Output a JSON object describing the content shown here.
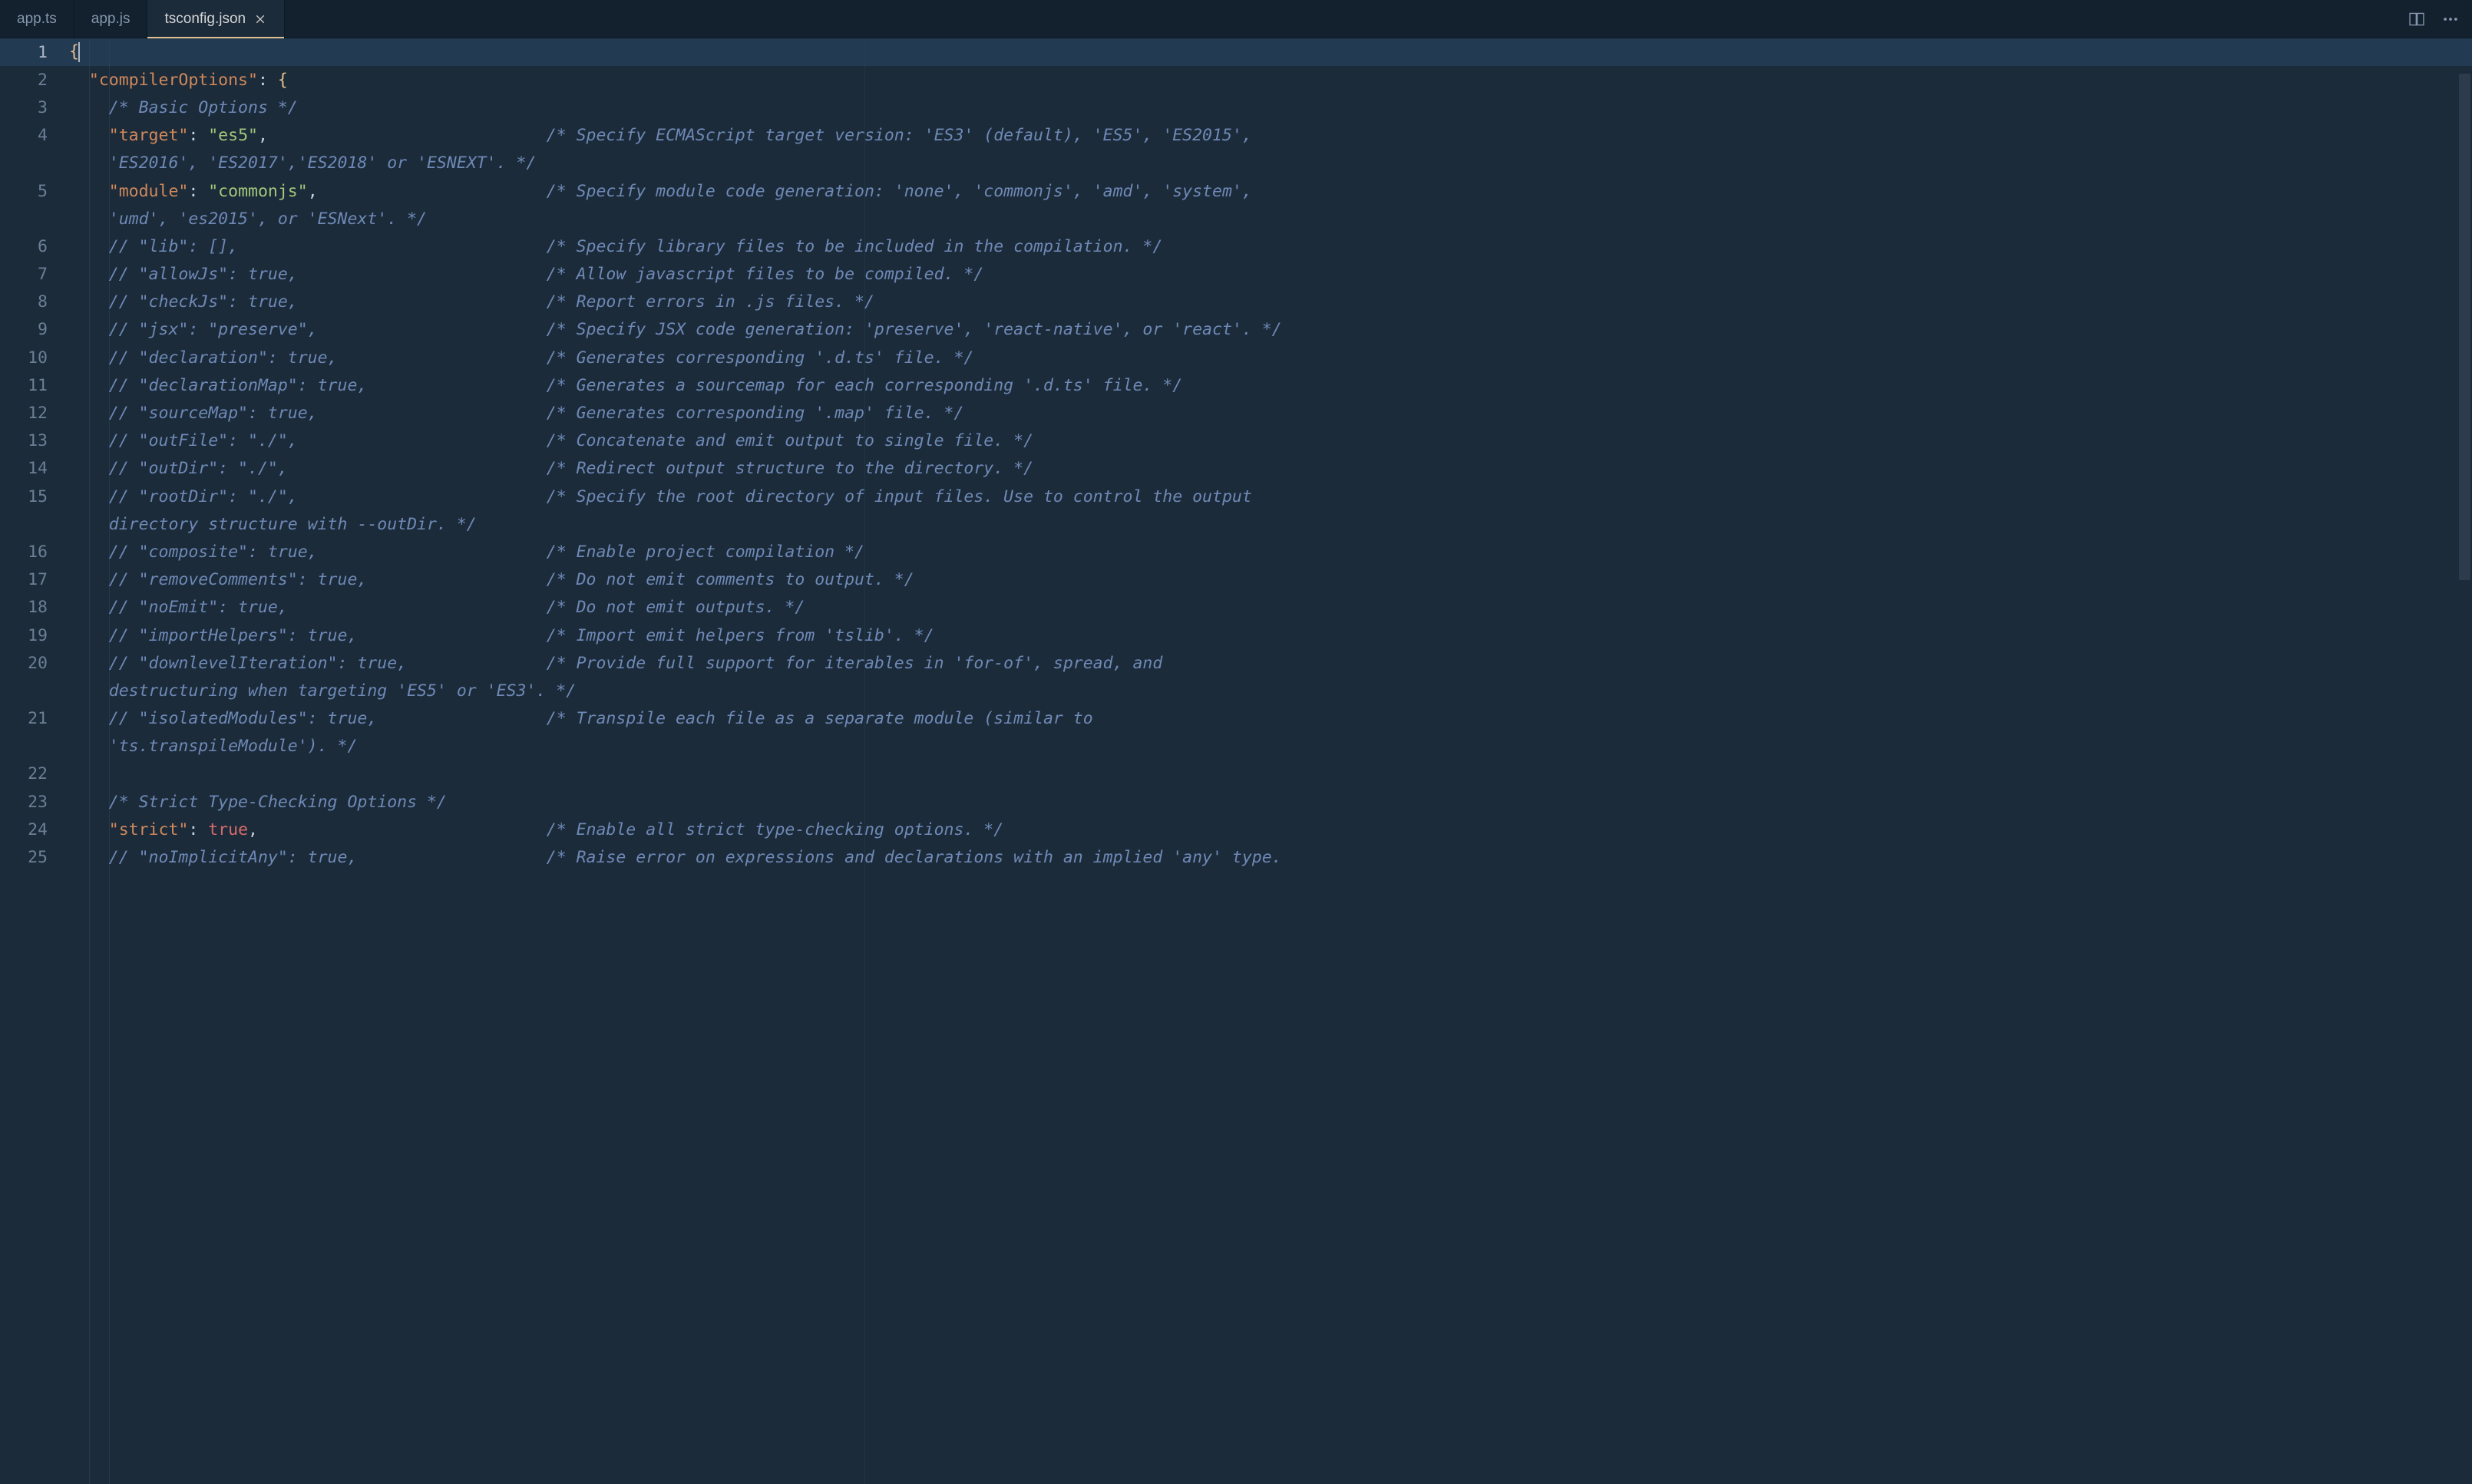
{
  "tabs": [
    {
      "label": "app.ts",
      "active": false,
      "dirty": false
    },
    {
      "label": "app.js",
      "active": false,
      "dirty": false
    },
    {
      "label": "tsconfig.json",
      "active": true,
      "dirty": false
    }
  ],
  "editor": {
    "rulerColumn": 80,
    "commentColumn": 48,
    "cursorLine": 1,
    "lines": [
      {
        "n": 1,
        "indent": 0,
        "segs": [
          {
            "t": "{",
            "c": "brace"
          }
        ]
      },
      {
        "n": 2,
        "indent": 2,
        "segs": [
          {
            "t": "\"compilerOptions\"",
            "c": "key"
          },
          {
            "t": ": ",
            "c": "punc"
          },
          {
            "t": "{",
            "c": "brace"
          }
        ]
      },
      {
        "n": 3,
        "indent": 4,
        "segs": [
          {
            "t": "/* Basic Options */",
            "c": "cmt"
          }
        ]
      },
      {
        "n": 4,
        "indent": 4,
        "segs": [
          {
            "t": "\"target\"",
            "c": "key"
          },
          {
            "t": ": ",
            "c": "punc"
          },
          {
            "t": "\"es5\"",
            "c": "str"
          },
          {
            "t": ",",
            "c": "punc"
          }
        ],
        "tail": "/* Specify ECMAScript target version: 'ES3' (default), 'ES5', 'ES2015', ",
        "wrap": "'ES2016', 'ES2017','ES2018' or 'ESNEXT'. */"
      },
      {
        "n": 5,
        "indent": 4,
        "segs": [
          {
            "t": "\"module\"",
            "c": "key"
          },
          {
            "t": ": ",
            "c": "punc"
          },
          {
            "t": "\"commonjs\"",
            "c": "str"
          },
          {
            "t": ",",
            "c": "punc"
          }
        ],
        "tail": "/* Specify module code generation: 'none', 'commonjs', 'amd', 'system', ",
        "wrap": "'umd', 'es2015', or 'ESNext'. */"
      },
      {
        "n": 6,
        "indent": 4,
        "segs": [
          {
            "t": "// \"lib\": [],",
            "c": "cmt"
          }
        ],
        "tail": "/* Specify library files to be included in the compilation. */"
      },
      {
        "n": 7,
        "indent": 4,
        "segs": [
          {
            "t": "// \"allowJs\": true,",
            "c": "cmt"
          }
        ],
        "tail": "/* Allow javascript files to be compiled. */"
      },
      {
        "n": 8,
        "indent": 4,
        "segs": [
          {
            "t": "// \"checkJs\": true,",
            "c": "cmt"
          }
        ],
        "tail": "/* Report errors in .js files. */"
      },
      {
        "n": 9,
        "indent": 4,
        "segs": [
          {
            "t": "// \"jsx\": \"preserve\",",
            "c": "cmt"
          }
        ],
        "tail": "/* Specify JSX code generation: 'preserve', 'react-native', or 'react'. */"
      },
      {
        "n": 10,
        "indent": 4,
        "segs": [
          {
            "t": "// \"declaration\": true,",
            "c": "cmt"
          }
        ],
        "tail": "/* Generates corresponding '.d.ts' file. */"
      },
      {
        "n": 11,
        "indent": 4,
        "segs": [
          {
            "t": "// \"declarationMap\": true,",
            "c": "cmt"
          }
        ],
        "tail": "/* Generates a sourcemap for each corresponding '.d.ts' file. */"
      },
      {
        "n": 12,
        "indent": 4,
        "segs": [
          {
            "t": "// \"sourceMap\": true,",
            "c": "cmt"
          }
        ],
        "tail": "/* Generates corresponding '.map' file. */"
      },
      {
        "n": 13,
        "indent": 4,
        "segs": [
          {
            "t": "// \"outFile\": \"./\",",
            "c": "cmt"
          }
        ],
        "tail": "/* Concatenate and emit output to single file. */"
      },
      {
        "n": 14,
        "indent": 4,
        "segs": [
          {
            "t": "// \"outDir\": \"./\",",
            "c": "cmt"
          }
        ],
        "tail": "/* Redirect output structure to the directory. */"
      },
      {
        "n": 15,
        "indent": 4,
        "segs": [
          {
            "t": "// \"rootDir\": \"./\",",
            "c": "cmt"
          }
        ],
        "tail": "/* Specify the root directory of input files. Use to control the output ",
        "wrap": "directory structure with --outDir. */"
      },
      {
        "n": 16,
        "indent": 4,
        "segs": [
          {
            "t": "// \"composite\": true,",
            "c": "cmt"
          }
        ],
        "tail": "/* Enable project compilation */"
      },
      {
        "n": 17,
        "indent": 4,
        "segs": [
          {
            "t": "// \"removeComments\": true,",
            "c": "cmt"
          }
        ],
        "tail": "/* Do not emit comments to output. */"
      },
      {
        "n": 18,
        "indent": 4,
        "segs": [
          {
            "t": "// \"noEmit\": true,",
            "c": "cmt"
          }
        ],
        "tail": "/* Do not emit outputs. */"
      },
      {
        "n": 19,
        "indent": 4,
        "segs": [
          {
            "t": "// \"importHelpers\": true,",
            "c": "cmt"
          }
        ],
        "tail": "/* Import emit helpers from 'tslib'. */"
      },
      {
        "n": 20,
        "indent": 4,
        "segs": [
          {
            "t": "// \"downlevelIteration\": true,",
            "c": "cmt"
          }
        ],
        "tail": "/* Provide full support for iterables in 'for-of', spread, and ",
        "wrap": "destructuring when targeting 'ES5' or 'ES3'. */"
      },
      {
        "n": 21,
        "indent": 4,
        "segs": [
          {
            "t": "// \"isolatedModules\": true,",
            "c": "cmt"
          }
        ],
        "tail": "/* Transpile each file as a separate module (similar to ",
        "wrap": "'ts.transpileModule'). */"
      },
      {
        "n": 22,
        "indent": 4,
        "segs": []
      },
      {
        "n": 23,
        "indent": 4,
        "segs": [
          {
            "t": "/* Strict Type-Checking Options */",
            "c": "cmt"
          }
        ]
      },
      {
        "n": 24,
        "indent": 4,
        "segs": [
          {
            "t": "\"strict\"",
            "c": "key"
          },
          {
            "t": ": ",
            "c": "punc"
          },
          {
            "t": "true",
            "c": "bool"
          },
          {
            "t": ",",
            "c": "punc"
          }
        ],
        "tail": "/* Enable all strict type-checking options. */"
      },
      {
        "n": 25,
        "indent": 4,
        "segs": [
          {
            "t": "// \"noImplicitAny\": true,",
            "c": "cmt"
          }
        ],
        "tail": "/* Raise error on expressions and declarations with an implied 'any' type. "
      }
    ]
  }
}
